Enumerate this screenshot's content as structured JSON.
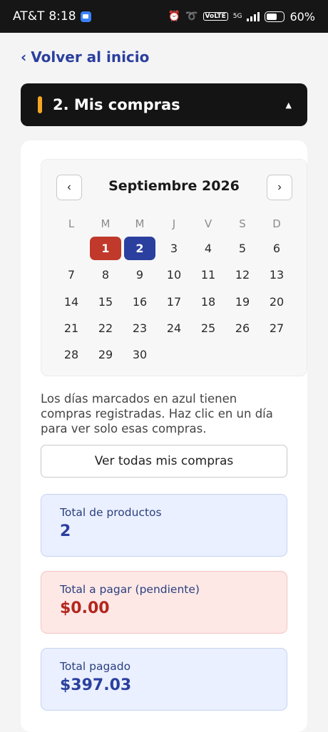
{
  "status_bar": {
    "carrier": "AT&T",
    "time": "8:18",
    "volte_label": "VoLTE",
    "network": "5G",
    "battery": "60%",
    "battery_level": 0.6
  },
  "back_link": {
    "label": "Volver al inicio"
  },
  "section": {
    "title": "2. Mis compras",
    "accent_color": "#f5a623"
  },
  "calendar": {
    "month_label": "Septiembre 2026",
    "weekdays": [
      "L",
      "M",
      "M",
      "J",
      "V",
      "S",
      "D"
    ],
    "leading_blanks": 1,
    "days": [
      "1",
      "2",
      "3",
      "4",
      "5",
      "6",
      "7",
      "8",
      "9",
      "10",
      "11",
      "12",
      "13",
      "14",
      "15",
      "16",
      "17",
      "18",
      "19",
      "20",
      "21",
      "22",
      "23",
      "24",
      "25",
      "26",
      "27",
      "28",
      "29",
      "30"
    ],
    "today": "1",
    "marked_days": [
      "2"
    ],
    "today_color": "#c0392b",
    "marked_color": "#2b3f9e"
  },
  "info": {
    "text": "Los días marcados en azul tienen compras registradas. Haz clic en un día para ver solo esas compras."
  },
  "view_all_button": {
    "label": "Ver todas mis compras"
  },
  "stats": [
    {
      "label": "Total de productos",
      "value": "2"
    },
    {
      "label": "Total a pagar (pendiente)",
      "value": "$0.00"
    },
    {
      "label": "Total pagado",
      "value": "$397.03"
    }
  ]
}
